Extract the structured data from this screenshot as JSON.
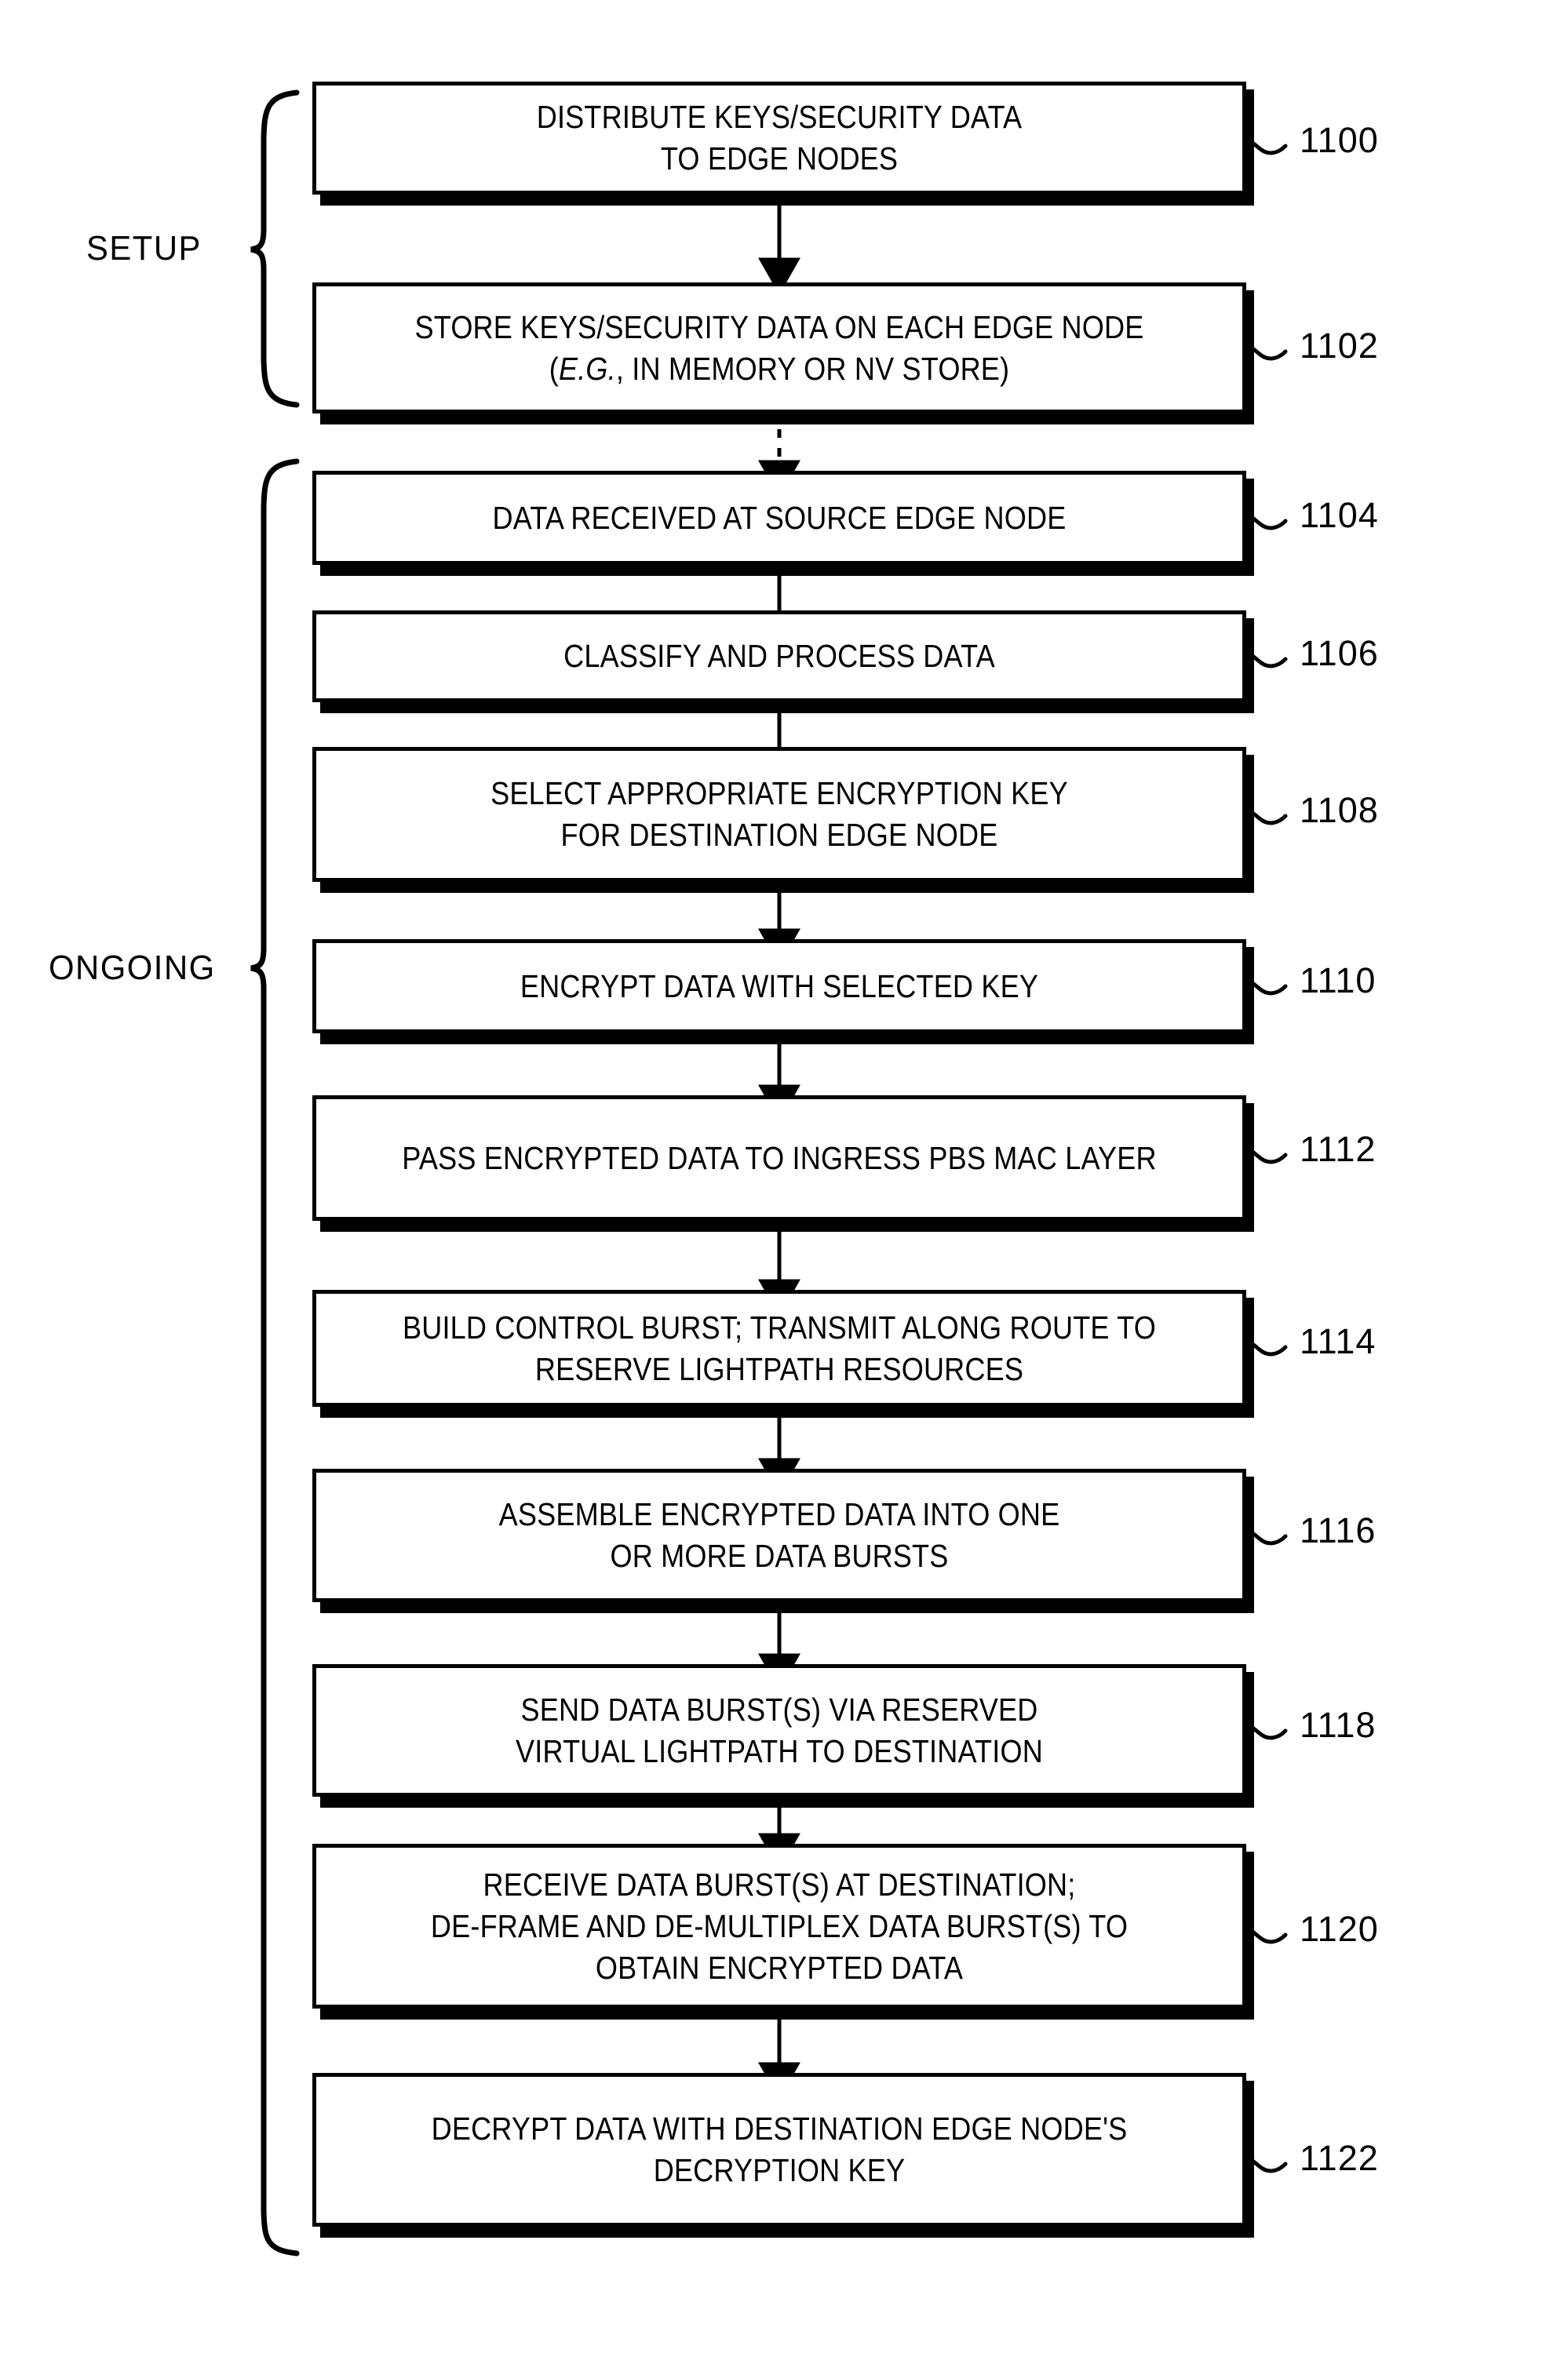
{
  "figure": {
    "kind": "patent-flowchart",
    "background_color": "#ffffff",
    "line_color": "#000000"
  },
  "groups": [
    {
      "id": "setup",
      "label": "SETUP"
    },
    {
      "id": "ongoing",
      "label": "ONGOING"
    }
  ],
  "steps": [
    {
      "ref": "1100",
      "group": "setup",
      "lines": [
        "DISTRIBUTE KEYS/SECURITY DATA",
        "TO EDGE NODES"
      ]
    },
    {
      "ref": "1102",
      "group": "setup",
      "lines": [
        "STORE KEYS/SECURITY DATA ON EACH EDGE NODE",
        "(E.G., IN MEMORY OR NV STORE)"
      ],
      "italic_prefix_line2": "E.G."
    },
    {
      "ref": "1104",
      "group": "ongoing",
      "lines": [
        "DATA RECEIVED AT SOURCE EDGE NODE"
      ]
    },
    {
      "ref": "1106",
      "group": "ongoing",
      "lines": [
        "CLASSIFY AND PROCESS DATA"
      ]
    },
    {
      "ref": "1108",
      "group": "ongoing",
      "lines": [
        "SELECT APPROPRIATE ENCRYPTION KEY",
        "FOR DESTINATION EDGE NODE"
      ]
    },
    {
      "ref": "1110",
      "group": "ongoing",
      "lines": [
        "ENCRYPT DATA WITH SELECTED KEY"
      ]
    },
    {
      "ref": "1112",
      "group": "ongoing",
      "lines": [
        "PASS ENCRYPTED DATA TO INGRESS PBS MAC LAYER"
      ]
    },
    {
      "ref": "1114",
      "group": "ongoing",
      "lines": [
        "BUILD CONTROL BURST; TRANSMIT ALONG ROUTE TO",
        "RESERVE LIGHTPATH RESOURCES"
      ]
    },
    {
      "ref": "1116",
      "group": "ongoing",
      "lines": [
        "ASSEMBLE ENCRYPTED DATA INTO ONE",
        "OR MORE DATA BURSTS"
      ]
    },
    {
      "ref": "1118",
      "group": "ongoing",
      "lines": [
        "SEND DATA BURST(S) VIA RESERVED",
        "VIRTUAL LIGHTPATH TO DESTINATION"
      ]
    },
    {
      "ref": "1120",
      "group": "ongoing",
      "lines": [
        "RECEIVE DATA BURST(S) AT DESTINATION;",
        "DE-FRAME AND DE-MULTIPLEX DATA BURST(S) TO",
        "OBTAIN ENCRYPTED DATA"
      ]
    },
    {
      "ref": "1122",
      "group": "ongoing",
      "lines": [
        "DECRYPT DATA WITH DESTINATION EDGE NODE'S",
        "DECRYPTION KEY"
      ]
    }
  ],
  "connectors": [
    {
      "from": "1100",
      "to": "1102",
      "style": "solid"
    },
    {
      "from": "1102",
      "to": "1104",
      "style": "dashed"
    },
    {
      "from": "1104",
      "to": "1106",
      "style": "solid"
    },
    {
      "from": "1106",
      "to": "1108",
      "style": "solid"
    },
    {
      "from": "1108",
      "to": "1110",
      "style": "solid"
    },
    {
      "from": "1110",
      "to": "1112",
      "style": "solid"
    },
    {
      "from": "1112",
      "to": "1114",
      "style": "solid"
    },
    {
      "from": "1114",
      "to": "1116",
      "style": "solid"
    },
    {
      "from": "1116",
      "to": "1118",
      "style": "solid"
    },
    {
      "from": "1118",
      "to": "1120",
      "style": "solid"
    },
    {
      "from": "1120",
      "to": "1122",
      "style": "solid"
    }
  ]
}
